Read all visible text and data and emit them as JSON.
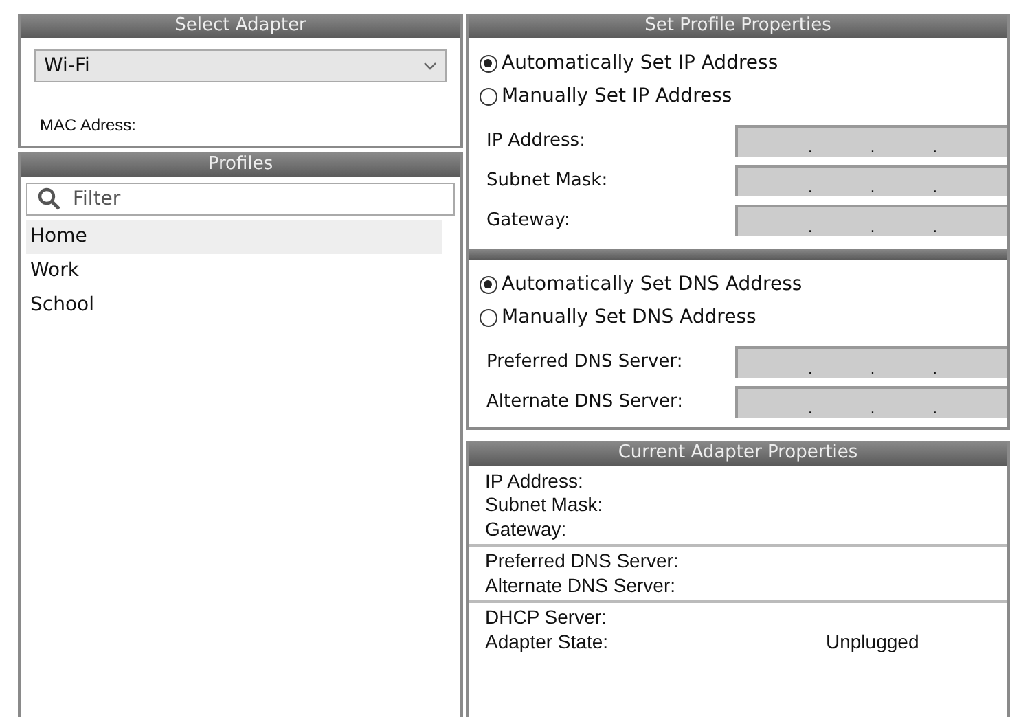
{
  "adapter": {
    "title": "Select Adapter",
    "selected_adapter": "Wi-Fi",
    "mac_label": "MAC Adress:"
  },
  "profiles": {
    "title": "Profiles",
    "filter_placeholder": "Filter",
    "items": [
      {
        "label": "Home",
        "selected": true
      },
      {
        "label": "Work",
        "selected": false
      },
      {
        "label": "School",
        "selected": false
      }
    ]
  },
  "profile_properties": {
    "title": "Set Profile Properties",
    "ip_options": [
      {
        "label": "Automatically Set IP Address",
        "selected": true
      },
      {
        "label": "Manually Set IP Address",
        "selected": false
      }
    ],
    "ip_fields": [
      {
        "label": "IP Address:",
        "dots": [
          ".",
          ".",
          "."
        ]
      },
      {
        "label": "Subnet Mask:",
        "dots": [
          ".",
          ".",
          "."
        ]
      },
      {
        "label": "Gateway:",
        "dots": [
          ".",
          ".",
          "."
        ]
      }
    ],
    "dns_options": [
      {
        "label": "Automatically Set DNS Address",
        "selected": true
      },
      {
        "label": "Manually Set DNS Address",
        "selected": false
      }
    ],
    "dns_fields": [
      {
        "label": "Preferred DNS Server:",
        "dots": [
          ".",
          ".",
          "."
        ]
      },
      {
        "label": "Alternate DNS Server:",
        "dots": [
          ".",
          ".",
          "."
        ]
      }
    ]
  },
  "current_properties": {
    "title": "Current Adapter Properties",
    "groups": [
      [
        {
          "label": "IP Address:"
        },
        {
          "label": "Subnet Mask:"
        },
        {
          "label": "Gateway:"
        }
      ],
      [
        {
          "label": "Preferred DNS Server:"
        },
        {
          "label": "Alternate DNS Server:"
        }
      ],
      [
        {
          "label": "DHCP Server:"
        },
        {
          "label": "Adapter State:",
          "value": "Unplugged"
        }
      ]
    ]
  }
}
